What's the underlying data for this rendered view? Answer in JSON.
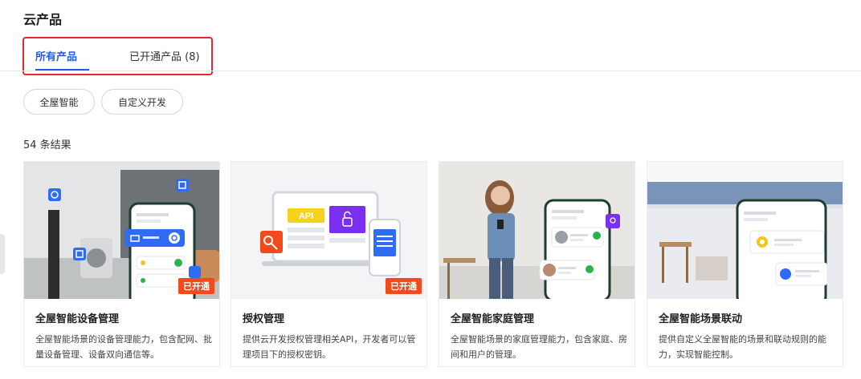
{
  "header": {
    "title": "云产品"
  },
  "tabs": [
    {
      "label": "所有产品"
    },
    {
      "label": "已开通产品 (8)"
    }
  ],
  "filters": [
    {
      "label": "全屋智能"
    },
    {
      "label": "自定义开发"
    }
  ],
  "results": {
    "count_text": "54 条结果"
  },
  "cards": [
    {
      "title": "全屋智能设备管理",
      "description": "全屋智能场景的设备管理能力，包含配网、批量设备管理、设备双向通信等。",
      "badge": "已开通"
    },
    {
      "title": "授权管理",
      "description": "提供云开发授权管理相关API，开发者可以管理项目下的授权密钥。",
      "badge": "已开通",
      "illustration_text": "API"
    },
    {
      "title": "全屋智能家庭管理",
      "description": "全屋智能场景的家庭管理能力，包含家庭、房间和用户的管理。"
    },
    {
      "title": "全屋智能场景联动",
      "description": "提供自定义全屋智能的场景和联动规则的能力，实现智能控制。"
    }
  ],
  "colors": {
    "accent": "#1f5cf2",
    "highlight_border": "#e8262c",
    "badge": "#f24a1d"
  }
}
